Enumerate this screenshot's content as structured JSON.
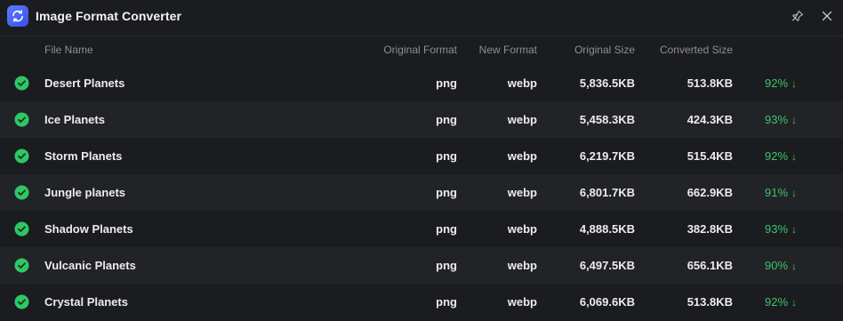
{
  "app": {
    "title": "Image Format Converter"
  },
  "colors": {
    "accent": "#4a63f0",
    "success": "#3cc56a",
    "background": "#1b1c1f",
    "row_alt": "#222327"
  },
  "table": {
    "headers": {
      "file_name": "File Name",
      "original_format": "Original Format",
      "new_format": "New Format",
      "original_size": "Original Size",
      "converted_size": "Converted Size"
    },
    "rows": [
      {
        "name": "Desert Planets",
        "original_format": "png",
        "new_format": "webp",
        "original_size": "5,836.5KB",
        "converted_size": "513.8KB",
        "reduction": "92%",
        "arrow": "↓"
      },
      {
        "name": "Ice Planets",
        "original_format": "png",
        "new_format": "webp",
        "original_size": "5,458.3KB",
        "converted_size": "424.3KB",
        "reduction": "93%",
        "arrow": "↓"
      },
      {
        "name": "Storm Planets",
        "original_format": "png",
        "new_format": "webp",
        "original_size": "6,219.7KB",
        "converted_size": "515.4KB",
        "reduction": "92%",
        "arrow": "↓"
      },
      {
        "name": "Jungle planets",
        "original_format": "png",
        "new_format": "webp",
        "original_size": "6,801.7KB",
        "converted_size": "662.9KB",
        "reduction": "91%",
        "arrow": "↓"
      },
      {
        "name": "Shadow Planets",
        "original_format": "png",
        "new_format": "webp",
        "original_size": "4,888.5KB",
        "converted_size": "382.8KB",
        "reduction": "93%",
        "arrow": "↓"
      },
      {
        "name": "Vulcanic Planets",
        "original_format": "png",
        "new_format": "webp",
        "original_size": "6,497.5KB",
        "converted_size": "656.1KB",
        "reduction": "90%",
        "arrow": "↓"
      },
      {
        "name": "Crystal Planets",
        "original_format": "png",
        "new_format": "webp",
        "original_size": "6,069.6KB",
        "converted_size": "513.8KB",
        "reduction": "92%",
        "arrow": "↓"
      }
    ]
  },
  "icons": {
    "app": "refresh-convert-icon",
    "pin": "pin-icon",
    "close": "close-icon",
    "status": "check-circle-icon"
  }
}
